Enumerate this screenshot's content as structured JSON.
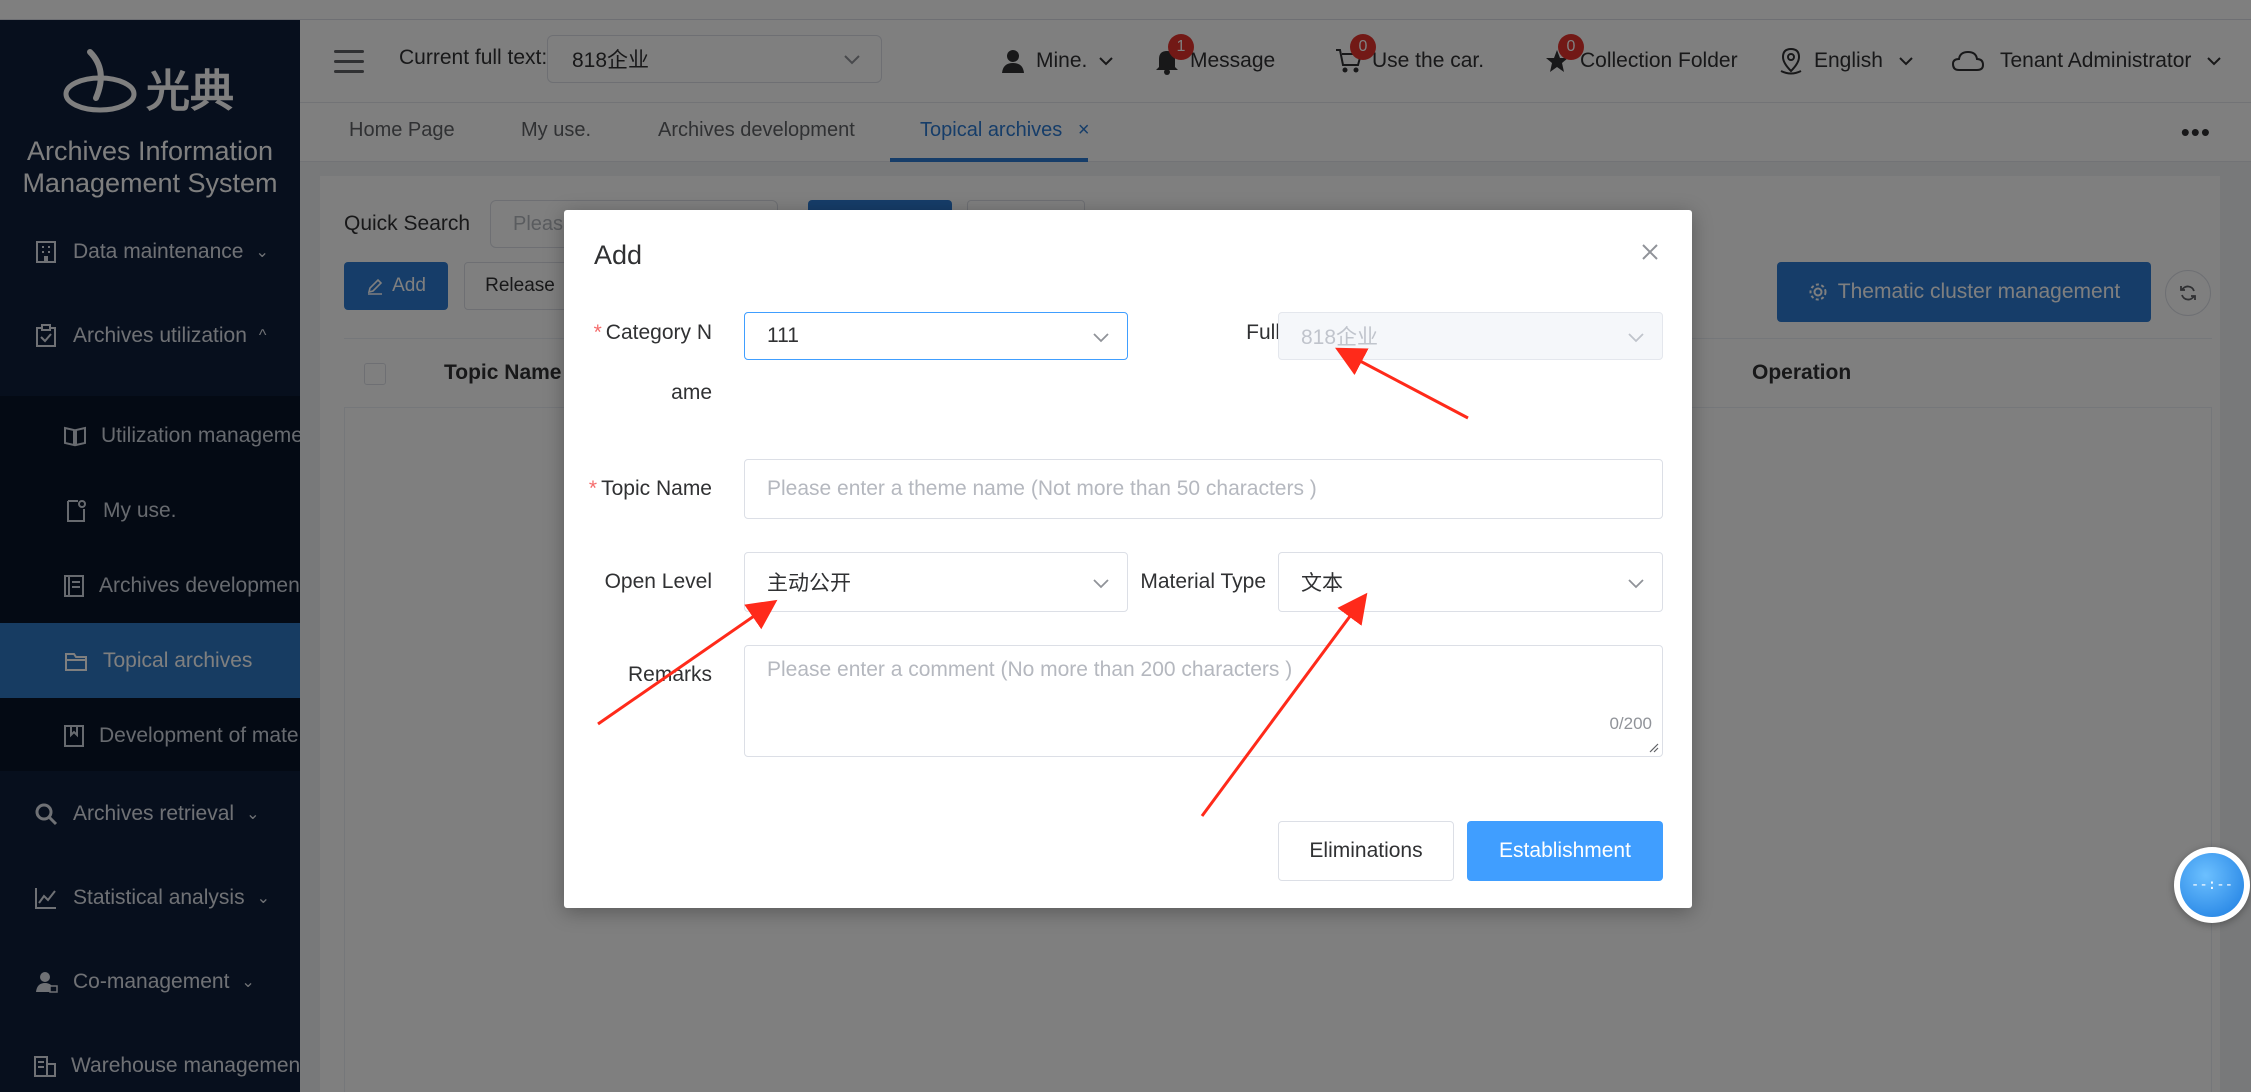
{
  "app": {
    "logo_text": "光典",
    "system_title_line1": "Archives Information",
    "system_title_line2": "Management System"
  },
  "sidebar": {
    "items": [
      {
        "label": "Data maintenance",
        "icon": "building-icon",
        "chevron": "⌄"
      },
      {
        "label": "Archives utilization",
        "icon": "clipboard-check-icon",
        "chevron": "^"
      },
      {
        "label": "Archives retrieval",
        "icon": "search-icon",
        "chevron": "⌄"
      },
      {
        "label": "Statistical analysis",
        "icon": "line-chart-icon",
        "chevron": "⌄"
      },
      {
        "label": "Co-management",
        "icon": "user-tie-icon",
        "chevron": "⌄"
      },
      {
        "label": "Warehouse management",
        "icon": "warehouse-icon",
        "chevron": "⌄"
      }
    ],
    "sub_items": [
      {
        "label": "Utilization management",
        "icon": "book-open-icon"
      },
      {
        "label": "My use.",
        "icon": "document-corner-icon"
      },
      {
        "label": "Archives development",
        "icon": "document-list-icon"
      },
      {
        "label": "Topical archives",
        "icon": "folder-icon"
      },
      {
        "label": "Development of materials",
        "icon": "bookmark-book-icon"
      }
    ]
  },
  "header": {
    "full_text_label": "Current full text:",
    "full_text_value": "818企业",
    "mine": "Mine.",
    "message": "Message",
    "message_count": "1",
    "car": "Use the car.",
    "car_count": "0",
    "collection": "Collection Folder",
    "collection_count": "0",
    "language": "English",
    "user": "Tenant Administrator"
  },
  "tabs": [
    {
      "label": "Home Page"
    },
    {
      "label": "My use."
    },
    {
      "label": "Archives development"
    },
    {
      "label": "Topical archives",
      "close": "×"
    }
  ],
  "tabs_more": "•••",
  "content": {
    "quick_search_label": "Quick Search",
    "quick_search_placeholder": "Pleas",
    "add_button": "Add",
    "release_button": "Release",
    "thematic_button": "Thematic cluster management",
    "columns": {
      "topic_name": "Topic Name",
      "operation": "Operation"
    }
  },
  "dialog": {
    "title": "Add",
    "category_label_line1": "Category N",
    "category_label_line2": "ame",
    "category_value": "111",
    "full_label": "Full",
    "full_value": "818企业",
    "topic_label": "Topic Name",
    "topic_placeholder": "Please enter a theme name (Not more than 50 characters )",
    "open_level_label": "Open Level",
    "open_level_value": "主动公开",
    "material_type_label": "Material Type",
    "material_type_value": "文本",
    "remarks_label": "Remarks",
    "remarks_placeholder": "Please enter a comment (No more than 200 characters )",
    "remarks_count": "0/200",
    "cancel_button": "Eliminations",
    "ok_button": "Establishment",
    "required_mark": "*"
  },
  "float_widget": "--:--",
  "colors": {
    "sidebar_bg": "#0f1e3a",
    "active_menu": "#2f78c4",
    "primary": "#409eff",
    "badge": "#e5322d",
    "annotation_arrow": "#ff2a1a"
  }
}
